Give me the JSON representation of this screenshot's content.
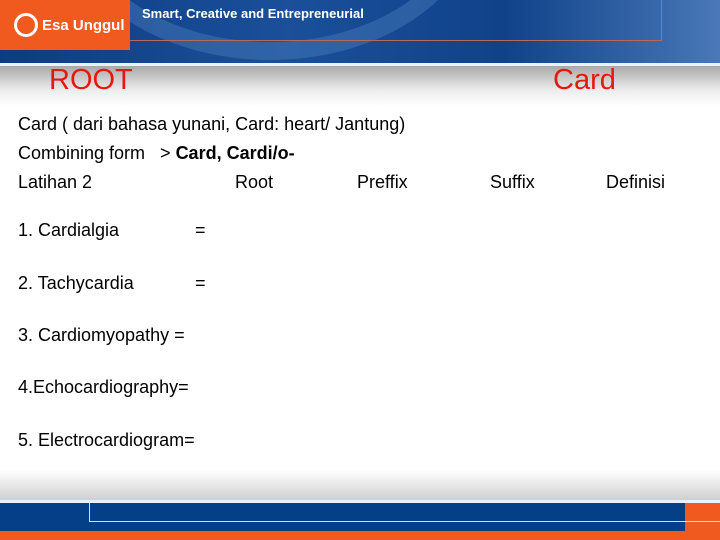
{
  "header": {
    "logo_text": "Esa Unggul",
    "tagline": "Smart, Creative and Entrepreneurial",
    "brand_orange": "#f15a1f",
    "brand_blue": "#0c3d82"
  },
  "slide": {
    "title_left": "ROOT",
    "title_right": "Card",
    "line1": "Card ( dari bahasa yunani, Card: heart/ Jantung)",
    "line2_prefix": "Combining form   > ",
    "line2_bold": "Card, Cardi/o-",
    "columns": [
      "Latihan 2",
      "Root",
      "Preffix",
      "Suffix",
      "Definisi"
    ],
    "items": [
      {
        "term": "1. Cardialgia",
        "eq": "="
      },
      {
        "term": "2. Tachycardia",
        "eq": "="
      },
      {
        "term": "3. Cardiomyopathy  ="
      },
      {
        "term": "4.Echocardiography="
      },
      {
        "term": "5. Electrocardiogram="
      }
    ]
  }
}
